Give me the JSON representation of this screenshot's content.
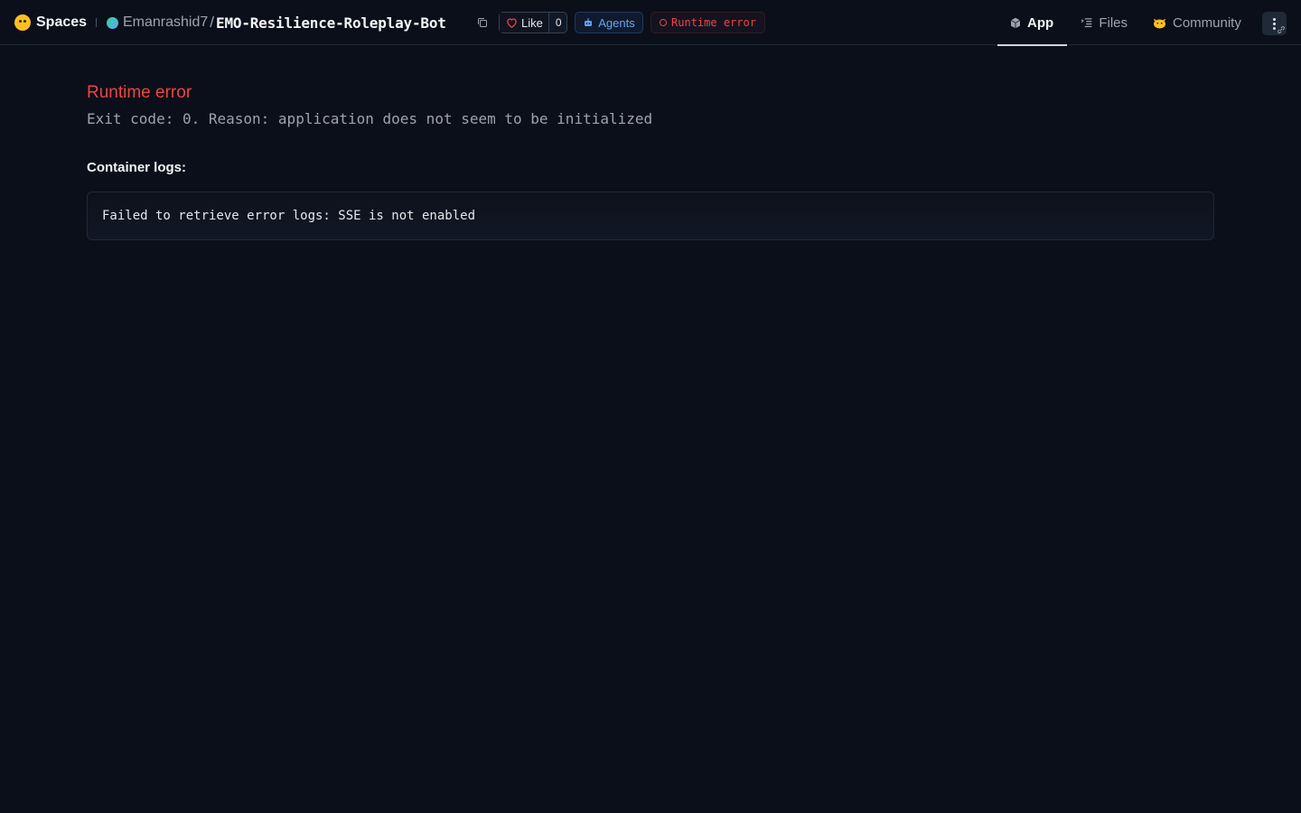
{
  "header": {
    "brand_label": "Spaces",
    "owner": "Emanrashid7",
    "separator": "/",
    "repo_name": "EMO-Resilience-Roleplay-Bot",
    "like": {
      "label": "Like",
      "count": "0"
    },
    "agents_label": "Agents",
    "status_label": "Runtime error"
  },
  "tabs": [
    {
      "label": "App",
      "icon": "cube-icon",
      "active": true
    },
    {
      "label": "Files",
      "icon": "files-icon",
      "active": false
    },
    {
      "label": "Community",
      "icon": "community-icon",
      "active": false
    }
  ],
  "error": {
    "title": "Runtime error",
    "reason": "Exit code: 0. Reason: application does not seem to be initialized"
  },
  "logs": {
    "label": "Container logs:",
    "content": "Failed to retrieve error logs: SSE is not enabled"
  },
  "colors": {
    "background": "#0b0f19",
    "error": "#ef4444",
    "accent_blue": "#60a5fa",
    "muted_text": "#9ca3af"
  }
}
